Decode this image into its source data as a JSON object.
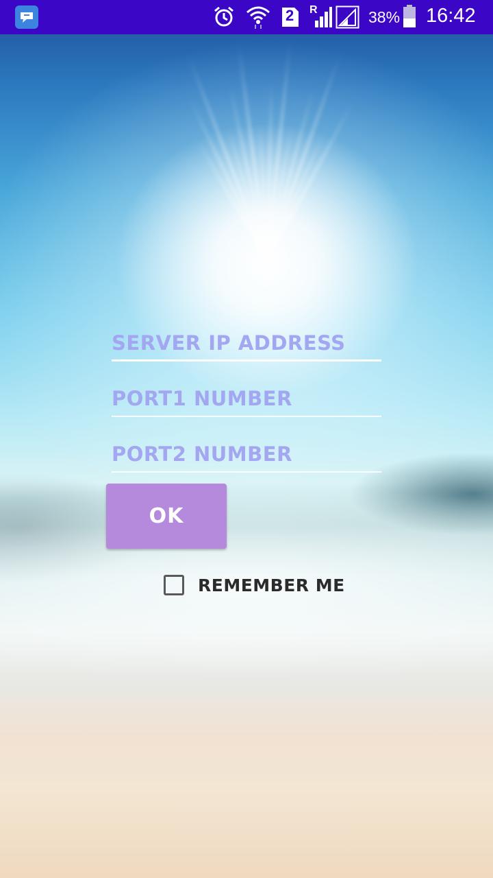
{
  "status_bar": {
    "battery_percent": "38%",
    "time": "16:42",
    "sim_badge": "2",
    "roaming_label": "R",
    "icons": [
      "app-icon",
      "alarm-icon",
      "wifi-icon",
      "sim2-icon",
      "signal-icon",
      "signal-icon",
      "battery-icon"
    ],
    "background_color": "#3b06c6"
  },
  "form": {
    "server_ip": {
      "placeholder": "SERVER IP ADDRESS",
      "value": ""
    },
    "port1": {
      "placeholder": "PORT1 NUMBER",
      "value": ""
    },
    "port2": {
      "placeholder": "PORT2 NUMBER",
      "value": ""
    },
    "ok_label": "OK",
    "remember_label": "REMEMBER ME",
    "remember_checked": false
  },
  "colors": {
    "hint_text": "#a3a6f0",
    "button": "#b58adc"
  }
}
